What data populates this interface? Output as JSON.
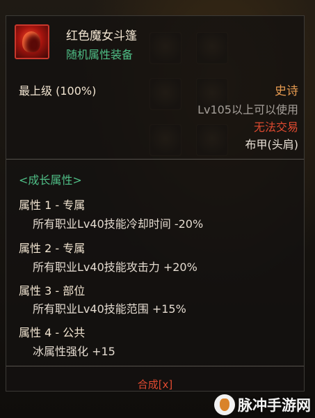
{
  "item": {
    "name": "红色魔女斗篷",
    "subtype": "随机属性装备",
    "grade": "最上级 (100%)",
    "rarity": "史诗",
    "level_requirement": "Lv105以上可以使用",
    "trade_status": "无法交易",
    "slot": "布甲(头肩)"
  },
  "growth": {
    "header": "<成长属性>",
    "attributes": [
      {
        "label": "属性 1 - 专属",
        "effect": "所有职业Lv40技能冷却时间 -20%"
      },
      {
        "label": "属性 2 - 专属",
        "effect": "所有职业Lv40技能攻击力 +20%"
      },
      {
        "label": "属性 3 - 部位",
        "effect": "所有职业Lv40技能范围 +15%"
      },
      {
        "label": "属性 4 - 公共",
        "effect": "冰属性强化 +15"
      }
    ]
  },
  "footer": {
    "craft": "合成[x]"
  },
  "watermark": {
    "text": "脉冲手游网"
  },
  "colors": {
    "growth_green": "#4fbe86",
    "rarity_orange": "#e59a50",
    "trade_red": "#e04a30"
  }
}
